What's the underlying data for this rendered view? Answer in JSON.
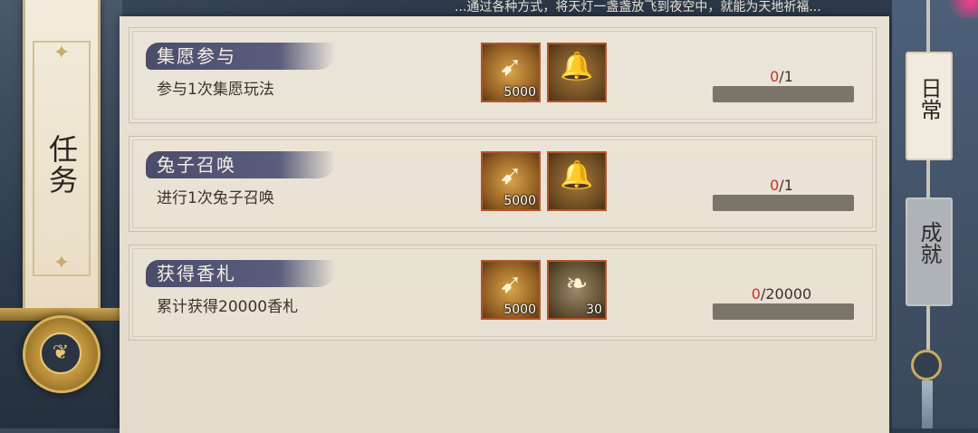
{
  "header": {
    "top_text": "...通过各种方式，将天灯一盏盏放飞到夜空中，就能为天地祈福..."
  },
  "left_banner": {
    "title": "任务"
  },
  "quests": [
    {
      "title": "集愿参与",
      "description": "参与1次集愿玩法",
      "rewards": [
        {
          "icon": "golden-arrow-bundle-icon",
          "count": "5000"
        },
        {
          "icon": "golden-bell-icon",
          "count": ""
        }
      ],
      "progress_current": "0",
      "progress_target": "/1",
      "progress_fraction": 0
    },
    {
      "title": "兔子召唤",
      "description": "进行1次兔子召唤",
      "rewards": [
        {
          "icon": "golden-arrow-bundle-icon",
          "count": "5000"
        },
        {
          "icon": "golden-bell-icon",
          "count": ""
        }
      ],
      "progress_current": "0",
      "progress_target": "/1",
      "progress_fraction": 0
    },
    {
      "title": "获得香札",
      "description": "累计获得20000香札",
      "rewards": [
        {
          "icon": "golden-arrow-bundle-icon",
          "count": "5000"
        },
        {
          "icon": "white-feather-icon",
          "count": "30"
        }
      ],
      "progress_current": "0",
      "progress_target": "/20000",
      "progress_fraction": 0
    }
  ],
  "tabs": [
    {
      "label": "日常",
      "active": true
    },
    {
      "label": "成就",
      "active": false
    }
  ],
  "colors": {
    "progress_current": "#c8321e",
    "panel_bg": "#e9e2d4",
    "title_brush": "#4a4d6a"
  }
}
